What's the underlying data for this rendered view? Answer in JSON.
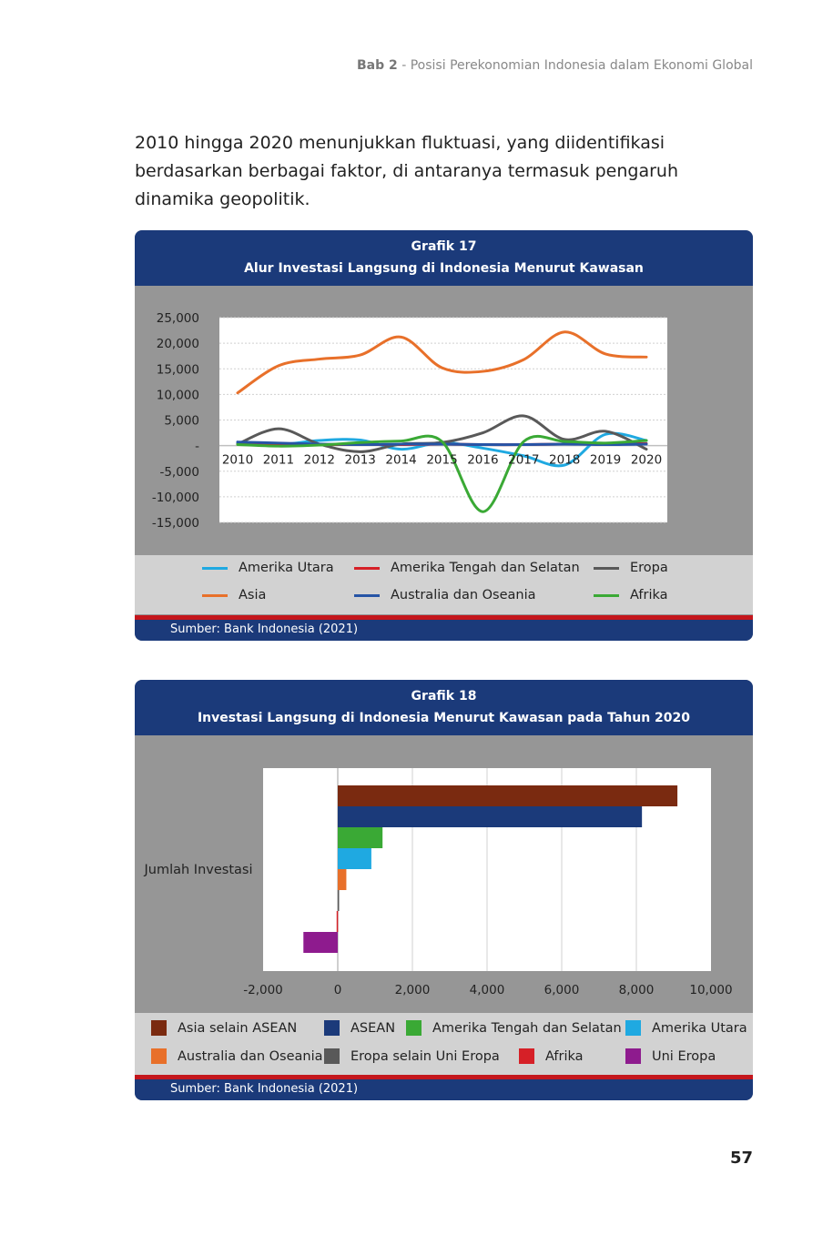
{
  "running_head": {
    "chapter": "Bab 2",
    "title": "- Posisi Perekonomian Indonesia dalam Ekonomi Global"
  },
  "intro_text": "2010 hingga 2020 menunjukkan fluktuasi, yang diidentifikasi berdasarkan berbagai faktor, di antaranya termasuk pengaruh dinamika geopolitik.",
  "page_number": "57",
  "chart_data": [
    {
      "type": "line",
      "caption_number": "Grafik 17",
      "title": "Alur Investasi Langsung di Indonesia Menurut Kawasan",
      "source": "Sumber: Bank Indonesia (2021)",
      "x": [
        "2010",
        "2011",
        "2012",
        "2013",
        "2014",
        "2015",
        "2016",
        "2017",
        "2018",
        "2019",
        "2020"
      ],
      "y_ticks": [
        "25,000",
        "20,000",
        "15,000",
        "10,000",
        "5,000",
        "-",
        "-5,000",
        "-10,000",
        "-15,000"
      ],
      "ylim": [
        -15000,
        25000
      ],
      "grid": true,
      "legend_position": "bottom",
      "series": [
        {
          "name": "Amerika Utara",
          "color": "#1fa9e1",
          "values": [
            500,
            200,
            1000,
            1100,
            -700,
            600,
            -500,
            -2000,
            -3800,
            2200,
            1000
          ]
        },
        {
          "name": "Amerika Tengah dan Selatan",
          "color": "#d62027",
          "values": [
            300,
            200,
            200,
            200,
            200,
            300,
            200,
            200,
            300,
            300,
            400
          ]
        },
        {
          "name": "Eropa",
          "color": "#595959",
          "values": [
            300,
            3300,
            300,
            -1200,
            300,
            600,
            2500,
            5800,
            1200,
            2800,
            -700
          ]
        },
        {
          "name": "Asia",
          "color": "#e8702a",
          "values": [
            10300,
            15600,
            16900,
            17700,
            21200,
            15200,
            14500,
            16800,
            22200,
            17900,
            17300
          ]
        },
        {
          "name": "Australia dan Oseania",
          "color": "#2654a6",
          "values": [
            700,
            500,
            300,
            200,
            300,
            300,
            200,
            200,
            300,
            200,
            300
          ]
        },
        {
          "name": "Afrika",
          "color": "#3aa935",
          "values": [
            200,
            -100,
            100,
            600,
            900,
            800,
            -12900,
            800,
            800,
            500,
            1000
          ]
        }
      ]
    },
    {
      "type": "bar",
      "orientation": "horizontal",
      "caption_number": "Grafik 18",
      "title": "Investasi Langsung di Indonesia Menurut Kawasan pada Tahun 2020",
      "source": "Sumber: Bank Indonesia (2021)",
      "category_label": "Jumlah Investasi",
      "x_ticks": [
        "-2,000",
        "0",
        "2,000",
        "4,000",
        "6,000",
        "8,000",
        "10,000"
      ],
      "xlim": [
        -2000,
        10000
      ],
      "grid": true,
      "legend_position": "bottom",
      "series": [
        {
          "name": "Asia selain ASEAN",
          "color": "#7a2a10",
          "value": 9100
        },
        {
          "name": "ASEAN",
          "color": "#1b3a7a",
          "value": 8150
        },
        {
          "name": "Amerika Tengah dan Selatan",
          "color": "#3aa935",
          "value": 1200
        },
        {
          "name": "Amerika Utara",
          "color": "#1fa9e1",
          "value": 900
        },
        {
          "name": "Australia dan Oseania",
          "color": "#e8702a",
          "value": 230
        },
        {
          "name": "Eropa selain Uni Eropa",
          "color": "#595959",
          "value": 30
        },
        {
          "name": "Afrika",
          "color": "#d62027",
          "value": -30
        },
        {
          "name": "Uni Eropa",
          "color": "#8e1b8e",
          "value": -920
        }
      ]
    }
  ]
}
